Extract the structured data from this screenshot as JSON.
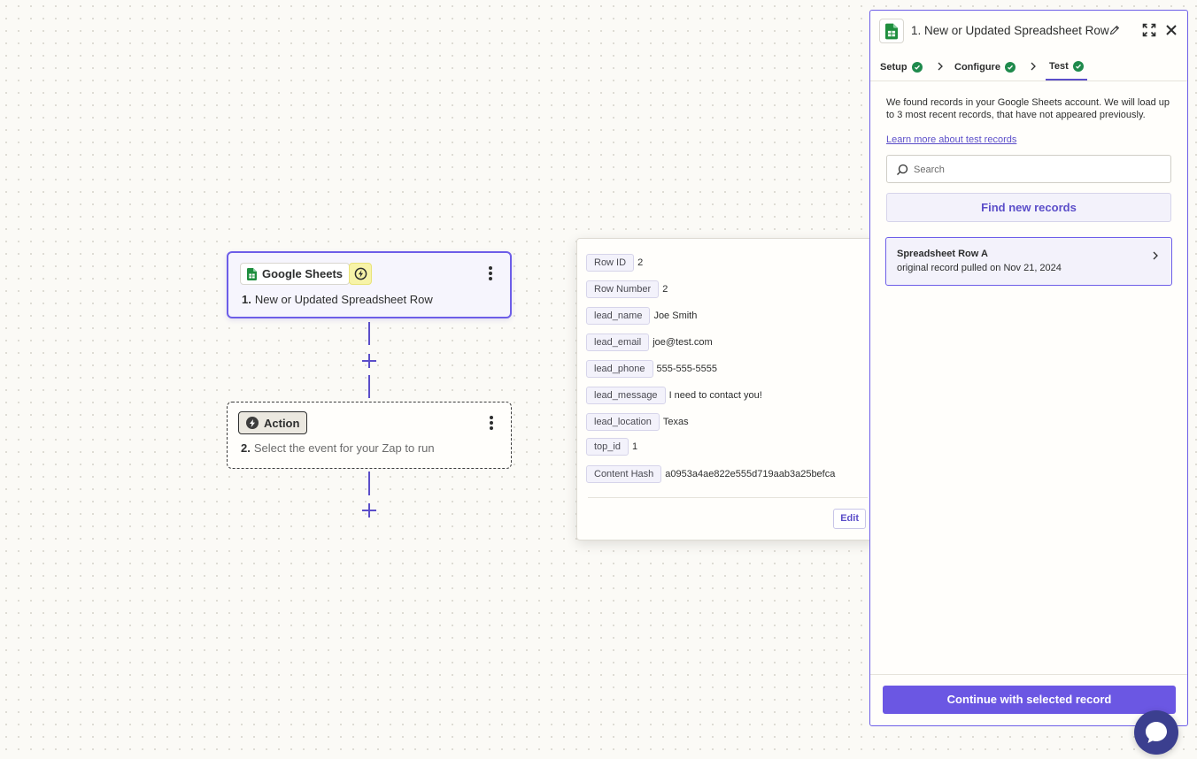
{
  "canvas": {
    "trigger_step": {
      "app_name": "Google Sheets",
      "number": "1.",
      "title": "New or Updated Spreadsheet Row",
      "icons": [
        "google-sheets-icon",
        "instant-bolt-icon",
        "more-vertical-icon"
      ]
    },
    "action_step": {
      "chip_label": "Action",
      "number": "2.",
      "title": "Select the event for your Zap to run",
      "icons": [
        "bolt-icon",
        "more-vertical-icon"
      ]
    }
  },
  "record_popover": {
    "fields": [
      {
        "key": "Row ID",
        "value": "2"
      },
      {
        "key": "Row Number",
        "value": "2"
      },
      {
        "key": "lead_name",
        "value": "Joe Smith"
      },
      {
        "key": "lead_email",
        "value": "joe@test.com"
      },
      {
        "key": "lead_phone",
        "value": "555-555-5555"
      },
      {
        "key": "lead_message",
        "value": "I need to contact you!"
      },
      {
        "key": "lead_location",
        "value": "Texas"
      },
      {
        "key": "top_id",
        "value": "1"
      },
      {
        "key": "Content Hash",
        "value": "a0953a4ae822e555d719aab3a25befca"
      }
    ],
    "edit_label": "Edit"
  },
  "panel": {
    "title": "1. New or Updated Spreadsheet Row",
    "tabs": [
      {
        "label": "Setup",
        "complete": true
      },
      {
        "label": "Configure",
        "complete": true
      },
      {
        "label": "Test",
        "complete": true,
        "active": true
      }
    ],
    "intro_text": "We found records in your Google Sheets account. We will load up to 3 most recent records, that have not appeared previously.",
    "learn_link": "Learn more about test records",
    "search_placeholder": "Search",
    "find_button": "Find new records",
    "record": {
      "title": "Spreadsheet Row A",
      "subtitle": "original record pulled on Nov 21, 2024"
    },
    "continue_button": "Continue with selected record"
  },
  "colors": {
    "accent": "#6b57e3",
    "accent_dark": "#5b4ec9",
    "success": "#1f8a4c",
    "sheets_green": "#1e8e3e"
  }
}
